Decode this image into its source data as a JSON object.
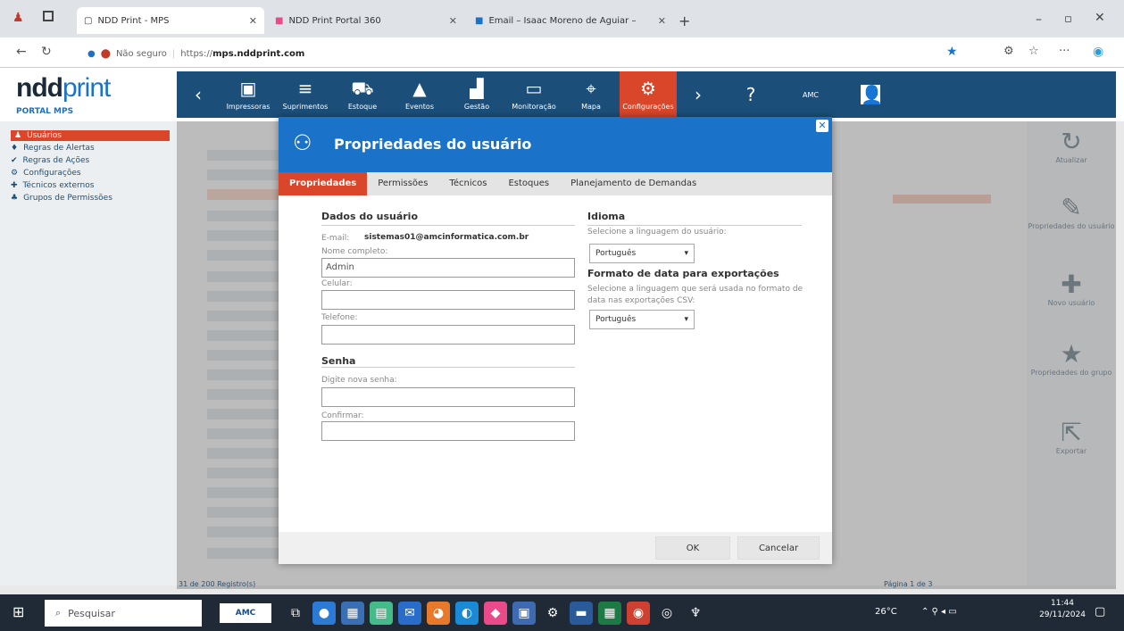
{
  "browser": {
    "tabs": [
      {
        "title": "NDD Print - MPS"
      },
      {
        "title": "NDD Print Portal 360"
      },
      {
        "title": "Email – Isaac Moreno de Aguiar – "
      }
    ],
    "security_label": "Não seguro",
    "url_prefix": "https://",
    "url_host": "mps.nddprint.com"
  },
  "app": {
    "logo_bold": "ndd",
    "logo_rest": "print",
    "portal": "PORTAL MPS",
    "user": "AMC",
    "nav": [
      {
        "label": "Impressoras",
        "icon": "printer-icon"
      },
      {
        "label": "Suprimentos",
        "icon": "list-icon"
      },
      {
        "label": "Estoque",
        "icon": "cart-icon"
      },
      {
        "label": "Eventos",
        "icon": "warning-icon"
      },
      {
        "label": "Gestão",
        "icon": "chart-icon"
      },
      {
        "label": "Monitoração",
        "icon": "monitor-icon"
      },
      {
        "label": "Mapa",
        "icon": "map-icon"
      },
      {
        "label": "Configurações",
        "icon": "gears-icon"
      }
    ],
    "sidebar": [
      {
        "label": "Usuários",
        "selected": true
      },
      {
        "label": "Regras de Alertas"
      },
      {
        "label": "Regras de Ações"
      },
      {
        "label": "Configurações"
      },
      {
        "label": "Técnicos externos"
      },
      {
        "label": "Grupos de Permissões"
      }
    ],
    "footer_count": "31 de 200 Registro(s)",
    "pagination": "Página 1 de 3",
    "actions": [
      {
        "label": "Atualizar",
        "icon": "refresh-icon"
      },
      {
        "label": "Propriedades do usuário",
        "icon": "tools-icon"
      },
      {
        "label": "Novo usuário",
        "icon": "plus-icon"
      },
      {
        "label": "Propriedades do grupo",
        "icon": "star-icon"
      },
      {
        "label": "Exportar",
        "icon": "export-icon"
      }
    ]
  },
  "modal": {
    "title": "Propriedades do usuário",
    "tabs": [
      "Propriedades",
      "Permissões",
      "Técnicos",
      "Estoques",
      "Planejamento de Demandas"
    ],
    "user_section": "Dados do usuário",
    "email_label": "E-mail:",
    "email_value": "sistemas01@amcinformatica.com.br",
    "fullname_label": "Nome completo:",
    "fullname_value": "Admin",
    "cell_label": "Celular:",
    "cell_value": "",
    "phone_label": "Telefone:",
    "phone_value": "",
    "password_section": "Senha",
    "newpass_label": "Digite nova senha:",
    "confirm_label": "Confirmar:",
    "language_section": "Idioma",
    "language_hint": "Selecione a linguagem do usuário:",
    "language_value": "Português",
    "dateformat_section": "Formato de data para exportações",
    "dateformat_hint": "Selecione a linguagem que será usada no formato de data nas exportações CSV:",
    "dateformat_value": "Português",
    "ok_label": "OK",
    "cancel_label": "Cancelar"
  },
  "taskbar": {
    "search_placeholder": "Pesquisar",
    "app_label": "AMC",
    "temperature": "26°C",
    "time": "11:44",
    "date": "29/11/2024"
  }
}
